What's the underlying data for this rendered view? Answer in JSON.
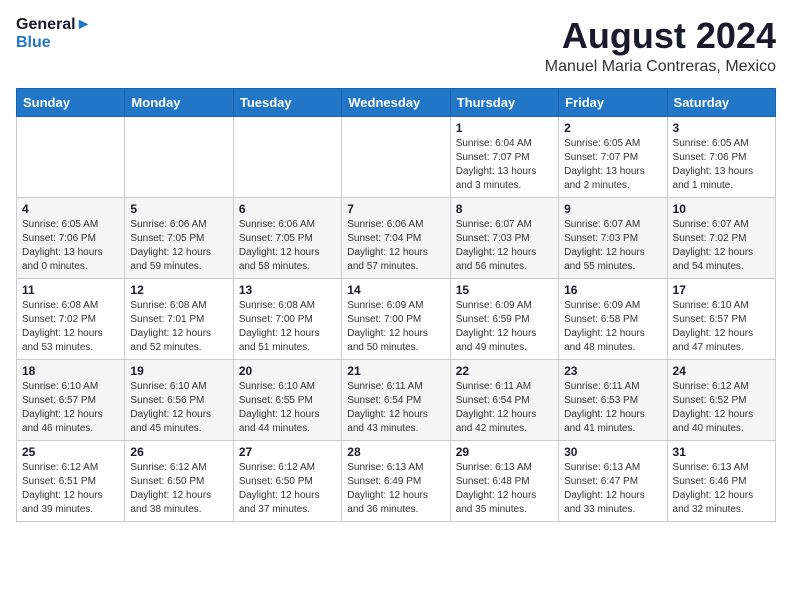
{
  "header": {
    "logo_line1": "General",
    "logo_line2": "Blue",
    "main_title": "August 2024",
    "sub_title": "Manuel Maria Contreras, Mexico"
  },
  "days_of_week": [
    "Sunday",
    "Monday",
    "Tuesday",
    "Wednesday",
    "Thursday",
    "Friday",
    "Saturday"
  ],
  "weeks": [
    [
      {
        "num": "",
        "info": ""
      },
      {
        "num": "",
        "info": ""
      },
      {
        "num": "",
        "info": ""
      },
      {
        "num": "",
        "info": ""
      },
      {
        "num": "1",
        "info": "Sunrise: 6:04 AM\nSunset: 7:07 PM\nDaylight: 13 hours\nand 3 minutes."
      },
      {
        "num": "2",
        "info": "Sunrise: 6:05 AM\nSunset: 7:07 PM\nDaylight: 13 hours\nand 2 minutes."
      },
      {
        "num": "3",
        "info": "Sunrise: 6:05 AM\nSunset: 7:06 PM\nDaylight: 13 hours\nand 1 minute."
      }
    ],
    [
      {
        "num": "4",
        "info": "Sunrise: 6:05 AM\nSunset: 7:06 PM\nDaylight: 13 hours\nand 0 minutes."
      },
      {
        "num": "5",
        "info": "Sunrise: 6:06 AM\nSunset: 7:05 PM\nDaylight: 12 hours\nand 59 minutes."
      },
      {
        "num": "6",
        "info": "Sunrise: 6:06 AM\nSunset: 7:05 PM\nDaylight: 12 hours\nand 58 minutes."
      },
      {
        "num": "7",
        "info": "Sunrise: 6:06 AM\nSunset: 7:04 PM\nDaylight: 12 hours\nand 57 minutes."
      },
      {
        "num": "8",
        "info": "Sunrise: 6:07 AM\nSunset: 7:03 PM\nDaylight: 12 hours\nand 56 minutes."
      },
      {
        "num": "9",
        "info": "Sunrise: 6:07 AM\nSunset: 7:03 PM\nDaylight: 12 hours\nand 55 minutes."
      },
      {
        "num": "10",
        "info": "Sunrise: 6:07 AM\nSunset: 7:02 PM\nDaylight: 12 hours\nand 54 minutes."
      }
    ],
    [
      {
        "num": "11",
        "info": "Sunrise: 6:08 AM\nSunset: 7:02 PM\nDaylight: 12 hours\nand 53 minutes."
      },
      {
        "num": "12",
        "info": "Sunrise: 6:08 AM\nSunset: 7:01 PM\nDaylight: 12 hours\nand 52 minutes."
      },
      {
        "num": "13",
        "info": "Sunrise: 6:08 AM\nSunset: 7:00 PM\nDaylight: 12 hours\nand 51 minutes."
      },
      {
        "num": "14",
        "info": "Sunrise: 6:09 AM\nSunset: 7:00 PM\nDaylight: 12 hours\nand 50 minutes."
      },
      {
        "num": "15",
        "info": "Sunrise: 6:09 AM\nSunset: 6:59 PM\nDaylight: 12 hours\nand 49 minutes."
      },
      {
        "num": "16",
        "info": "Sunrise: 6:09 AM\nSunset: 6:58 PM\nDaylight: 12 hours\nand 48 minutes."
      },
      {
        "num": "17",
        "info": "Sunrise: 6:10 AM\nSunset: 6:57 PM\nDaylight: 12 hours\nand 47 minutes."
      }
    ],
    [
      {
        "num": "18",
        "info": "Sunrise: 6:10 AM\nSunset: 6:57 PM\nDaylight: 12 hours\nand 46 minutes."
      },
      {
        "num": "19",
        "info": "Sunrise: 6:10 AM\nSunset: 6:56 PM\nDaylight: 12 hours\nand 45 minutes."
      },
      {
        "num": "20",
        "info": "Sunrise: 6:10 AM\nSunset: 6:55 PM\nDaylight: 12 hours\nand 44 minutes."
      },
      {
        "num": "21",
        "info": "Sunrise: 6:11 AM\nSunset: 6:54 PM\nDaylight: 12 hours\nand 43 minutes."
      },
      {
        "num": "22",
        "info": "Sunrise: 6:11 AM\nSunset: 6:54 PM\nDaylight: 12 hours\nand 42 minutes."
      },
      {
        "num": "23",
        "info": "Sunrise: 6:11 AM\nSunset: 6:53 PM\nDaylight: 12 hours\nand 41 minutes."
      },
      {
        "num": "24",
        "info": "Sunrise: 6:12 AM\nSunset: 6:52 PM\nDaylight: 12 hours\nand 40 minutes."
      }
    ],
    [
      {
        "num": "25",
        "info": "Sunrise: 6:12 AM\nSunset: 6:51 PM\nDaylight: 12 hours\nand 39 minutes."
      },
      {
        "num": "26",
        "info": "Sunrise: 6:12 AM\nSunset: 6:50 PM\nDaylight: 12 hours\nand 38 minutes."
      },
      {
        "num": "27",
        "info": "Sunrise: 6:12 AM\nSunset: 6:50 PM\nDaylight: 12 hours\nand 37 minutes."
      },
      {
        "num": "28",
        "info": "Sunrise: 6:13 AM\nSunset: 6:49 PM\nDaylight: 12 hours\nand 36 minutes."
      },
      {
        "num": "29",
        "info": "Sunrise: 6:13 AM\nSunset: 6:48 PM\nDaylight: 12 hours\nand 35 minutes."
      },
      {
        "num": "30",
        "info": "Sunrise: 6:13 AM\nSunset: 6:47 PM\nDaylight: 12 hours\nand 33 minutes."
      },
      {
        "num": "31",
        "info": "Sunrise: 6:13 AM\nSunset: 6:46 PM\nDaylight: 12 hours\nand 32 minutes."
      }
    ]
  ]
}
